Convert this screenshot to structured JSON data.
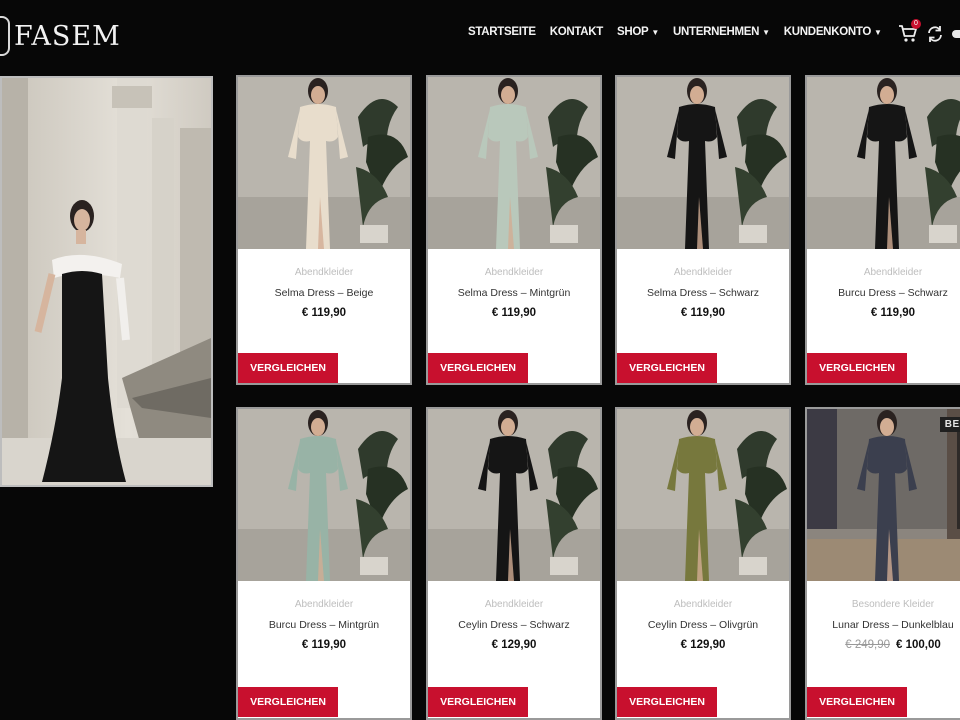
{
  "brand": {
    "name": "FASEM"
  },
  "nav": {
    "items": [
      {
        "label": "STARTSEITE",
        "dropdown": false
      },
      {
        "label": "KONTAKT",
        "dropdown": false
      },
      {
        "label": "SHOP",
        "dropdown": true
      },
      {
        "label": "UNTERNEHMEN",
        "dropdown": true
      },
      {
        "label": "KUNDENKONTO",
        "dropdown": true
      }
    ],
    "cart_count": "0",
    "icons": [
      "cart-icon",
      "refresh-icon"
    ]
  },
  "colors": {
    "accent": "#c8102e",
    "background": "#070707",
    "card": "#ffffff"
  },
  "products": [
    {
      "category": "Abendkleider",
      "name": "Selma Dress – Beige",
      "price": "€ 119,90",
      "old_price": "",
      "button": "VERGLEICHEN",
      "dress_color": "#e8ddcc"
    },
    {
      "category": "Abendkleider",
      "name": "Selma Dress – Mintgrün",
      "price": "€ 119,90",
      "old_price": "",
      "button": "VERGLEICHEN",
      "dress_color": "#b9c8bb"
    },
    {
      "category": "Abendkleider",
      "name": "Selma Dress – Schwarz",
      "price": "€ 119,90",
      "old_price": "",
      "button": "VERGLEICHEN",
      "dress_color": "#151515"
    },
    {
      "category": "Abendkleider",
      "name": "Burcu Dress – Schwarz",
      "price": "€ 119,90",
      "old_price": "",
      "button": "VERGLEICHEN",
      "dress_color": "#151515"
    },
    {
      "category": "Abendkleider",
      "name": "Burcu Dress – Mintgrün",
      "price": "€ 119,90",
      "old_price": "",
      "button": "VERGLEICHEN",
      "dress_color": "#98b3a6"
    },
    {
      "category": "Abendkleider",
      "name": "Ceylin Dress – Schwarz",
      "price": "€ 129,90",
      "old_price": "",
      "button": "VERGLEICHEN",
      "dress_color": "#151515"
    },
    {
      "category": "Abendkleider",
      "name": "Ceylin Dress – Olivgrün",
      "price": "€ 129,90",
      "old_price": "",
      "button": "VERGLEICHEN",
      "dress_color": "#77783d"
    },
    {
      "category": "Besondere Kleider",
      "name": "Lunar Dress – Dunkelblau",
      "price": "€ 100,00",
      "old_price": "€ 249,90",
      "button": "VERGLEICHEN",
      "dress_color": "#3b3f4e",
      "badge": "BEZU"
    }
  ]
}
